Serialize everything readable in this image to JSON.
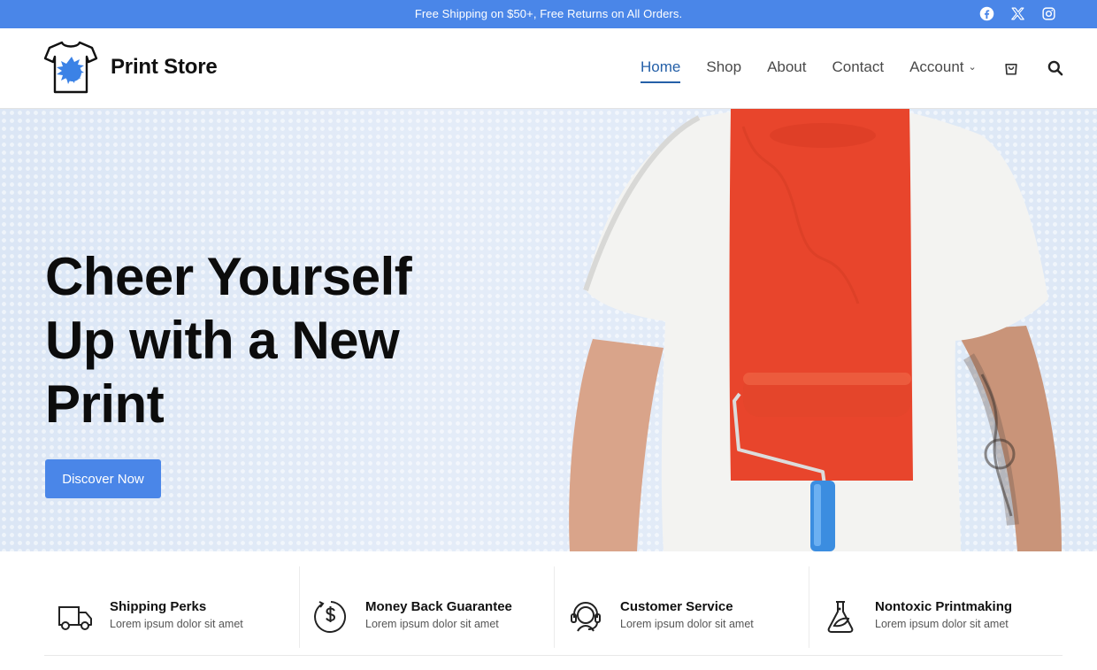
{
  "topbar": {
    "message": "Free Shipping on $50+, Free Returns on All Orders.",
    "social": [
      "facebook-icon",
      "x-icon",
      "instagram-icon"
    ]
  },
  "header": {
    "brand": "Print Store",
    "nav": [
      {
        "label": "Home",
        "active": true
      },
      {
        "label": "Shop"
      },
      {
        "label": "About"
      },
      {
        "label": "Contact"
      },
      {
        "label": "Account",
        "dropdown": true
      }
    ],
    "icons": [
      "cart-icon",
      "search-icon"
    ]
  },
  "hero": {
    "headline_line1": "Cheer Yourself",
    "headline_line2": "Up with a New",
    "headline_line3": "Print",
    "cta": "Discover Now"
  },
  "features": [
    {
      "icon": "truck-icon",
      "title": "Shipping Perks",
      "text": "Lorem ipsum dolor sit amet"
    },
    {
      "icon": "money-back-icon",
      "title": "Money Back Guarantee",
      "text": "Lorem ipsum dolor sit amet"
    },
    {
      "icon": "headset-icon",
      "title": "Customer Service",
      "text": "Lorem ipsum dolor sit amet"
    },
    {
      "icon": "flask-leaf-icon",
      "title": "Nontoxic Printmaking",
      "text": "Lorem ipsum dolor sit amet"
    }
  ],
  "colors": {
    "accent": "#4a86e8",
    "nav_active": "#2560a8",
    "text": "#111111"
  }
}
